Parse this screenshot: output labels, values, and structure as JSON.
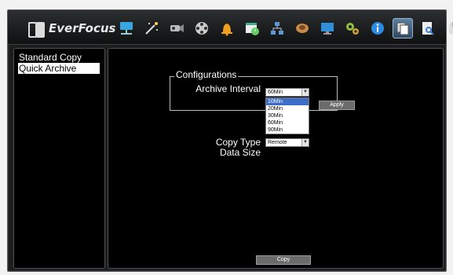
{
  "brand": {
    "name": "EverFocus"
  },
  "toolbar": {
    "icons": [
      "network-icon",
      "wand-icon",
      "camera-icon",
      "film-reel-icon",
      "bell-icon",
      "schedule-icon",
      "user-network-icon",
      "hdd-icon",
      "monitor-icon",
      "gears-icon",
      "info-icon",
      "copy-icon",
      "search-file-icon",
      "mouse-icon"
    ],
    "active_index": 11
  },
  "sidebar": {
    "items": [
      {
        "label": "Standard Copy",
        "selected": false
      },
      {
        "label": "Quick Archive",
        "selected": true
      }
    ]
  },
  "main": {
    "configurations": {
      "legend": "Configurations",
      "archive_interval_label": "Archive Interval",
      "archive_interval_value": "60Min",
      "archive_interval_options": [
        "10Min",
        "20Min",
        "30Min",
        "60Min",
        "90Min"
      ],
      "highlighted_option": "10Min",
      "apply_label": "Apply"
    },
    "copy_type_label": "Copy Type",
    "copy_type_value": "Remote",
    "data_size_label": "Data Size",
    "copy_label": "Copy"
  },
  "colors": {
    "frame_bg": "#1b1d1e",
    "panel_bg": "#000000",
    "highlight": "#3c6ec8",
    "button_bg": "#6b6b6b"
  }
}
